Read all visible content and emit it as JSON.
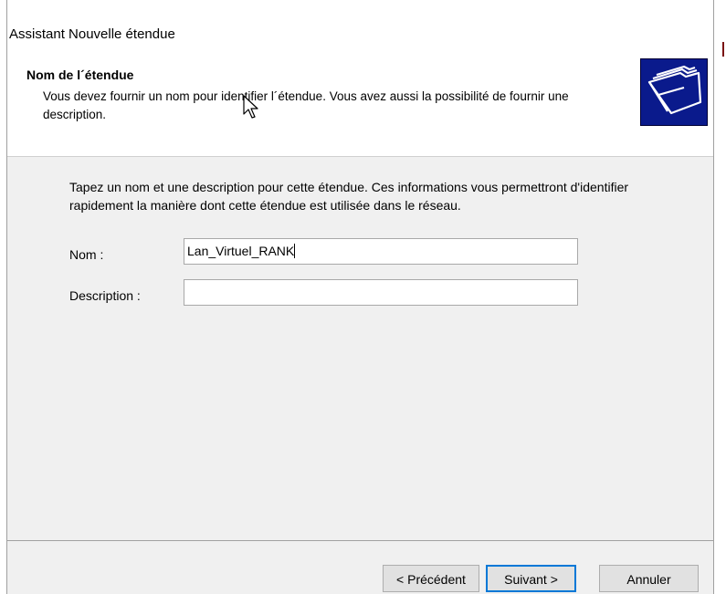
{
  "window": {
    "title": "Assistant Nouvelle étendue"
  },
  "header": {
    "title": "Nom de l´étendue",
    "description": "Vous devez fournir un nom pour identifier l´étendue. Vous avez aussi la possibilité de fournir une description.",
    "icon": "folders-icon"
  },
  "main": {
    "instructions": "Tapez un nom et une description pour cette étendue. Ces informations vous permettront d'identifier rapidement la manière dont cette étendue est utilisée dans le réseau.",
    "name_label": "Nom :",
    "name_value": "Lan_Virtuel_RANK",
    "description_label": "Description :",
    "description_value": ""
  },
  "footer": {
    "back_label": "< Précédent",
    "next_label": "Suivant >",
    "cancel_label": "Annuler"
  },
  "colors": {
    "accent": "#0078d7",
    "body_bg": "#f0f0f0"
  }
}
